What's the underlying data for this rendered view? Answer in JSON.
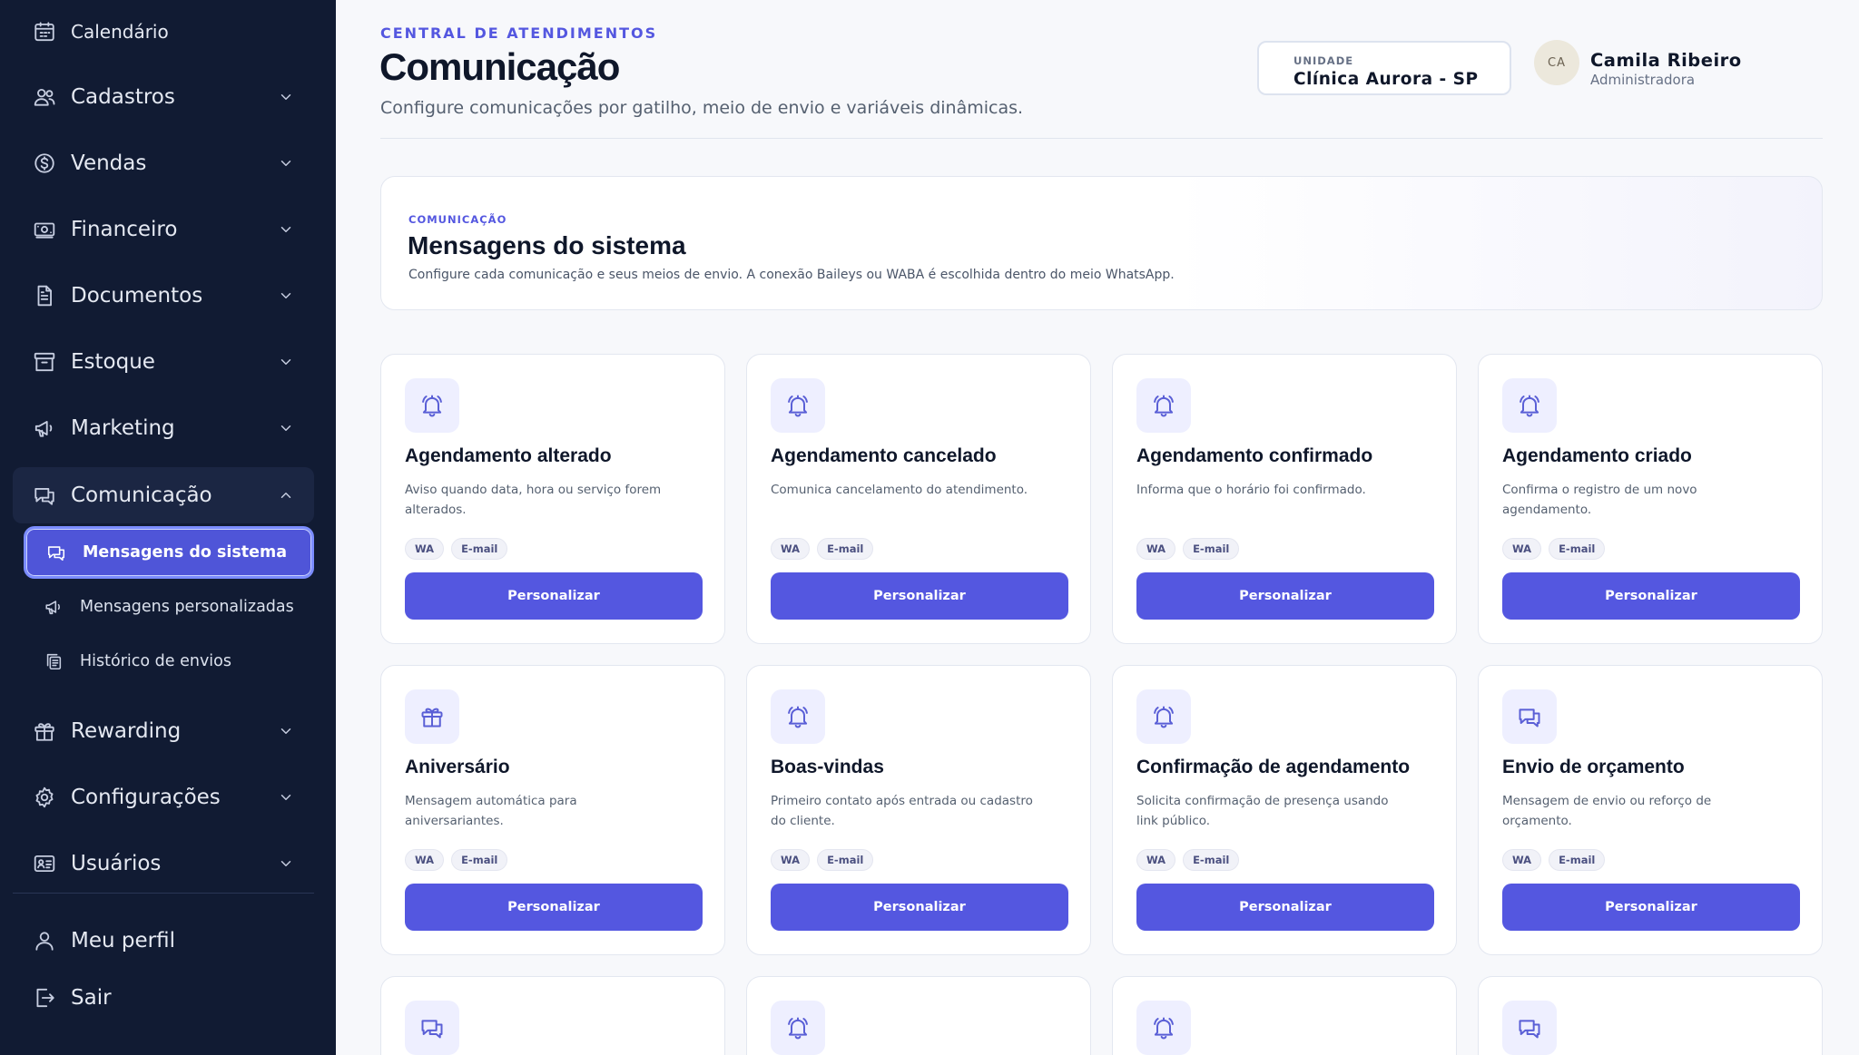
{
  "sidebar": {
    "items": [
      {
        "label": "Calendário",
        "icon": "calendar-icon"
      },
      {
        "label": "Cadastros",
        "icon": "users-icon"
      },
      {
        "label": "Vendas",
        "icon": "dollar-icon"
      },
      {
        "label": "Financeiro",
        "icon": "banknote-icon"
      },
      {
        "label": "Documentos",
        "icon": "file-icon"
      },
      {
        "label": "Estoque",
        "icon": "archive-icon"
      },
      {
        "label": "Marketing",
        "icon": "megaphone-icon"
      },
      {
        "label": "Comunicação",
        "icon": "chat-icon"
      },
      {
        "label": "Rewarding",
        "icon": "gift-icon"
      },
      {
        "label": "Configurações",
        "icon": "gear-icon"
      },
      {
        "label": "Usuários",
        "icon": "id-card-icon"
      }
    ],
    "subitems": [
      {
        "label": "Mensagens do sistema",
        "icon": "chat-icon"
      },
      {
        "label": "Mensagens personalizadas",
        "icon": "megaphone-icon"
      },
      {
        "label": "Histórico de envios",
        "icon": "copy-icon"
      }
    ],
    "footer": [
      {
        "label": "Meu perfil",
        "icon": "user-icon"
      },
      {
        "label": "Sair",
        "icon": "logout-icon"
      }
    ]
  },
  "header": {
    "kicker": "CENTRAL DE ATENDIMENTOS",
    "title": "Comunicação",
    "subtitle": "Configure comunicações por gatilho, meio de envio e variáveis dinâmicas.",
    "unit_label": "UNIDADE",
    "unit_value": "Clínica Aurora - SP",
    "avatar_initials": "CA",
    "user_name": "Camila Ribeiro",
    "user_role": "Administradora"
  },
  "intro": {
    "kicker": "COMUNICAÇÃO",
    "title": "Mensagens do sistema",
    "description": "Configure cada comunicação e seus meios de envio. A conexão Baileys ou WABA é escolhida dentro do meio WhatsApp."
  },
  "cards": [
    {
      "title": "Agendamento alterado",
      "description": "Aviso quando data, hora ou serviço forem alterados.",
      "tags": [
        "WA",
        "E-mail"
      ],
      "button": "Personalizar",
      "icon": "bell-icon"
    },
    {
      "title": "Agendamento cancelado",
      "description": "Comunica cancelamento do atendimento.",
      "tags": [
        "WA",
        "E-mail"
      ],
      "button": "Personalizar",
      "icon": "bell-icon"
    },
    {
      "title": "Agendamento confirmado",
      "description": "Informa que o horário foi confirmado.",
      "tags": [
        "WA",
        "E-mail"
      ],
      "button": "Personalizar",
      "icon": "bell-icon"
    },
    {
      "title": "Agendamento criado",
      "description": "Confirma o registro de um novo agendamento.",
      "tags": [
        "WA",
        "E-mail"
      ],
      "button": "Personalizar",
      "icon": "bell-icon"
    },
    {
      "title": "Aniversário",
      "description": "Mensagem automática para aniversariantes.",
      "tags": [
        "WA",
        "E-mail"
      ],
      "button": "Personalizar",
      "icon": "gift-icon"
    },
    {
      "title": "Boas-vindas",
      "description": "Primeiro contato após entrada ou cadastro do cliente.",
      "tags": [
        "WA",
        "E-mail"
      ],
      "button": "Personalizar",
      "icon": "bell-icon"
    },
    {
      "title": "Confirmação de agendamento",
      "description": "Solicita confirmação de presença usando link público.",
      "tags": [
        "WA",
        "E-mail"
      ],
      "button": "Personalizar",
      "icon": "bell-icon"
    },
    {
      "title": "Envio de orçamento",
      "description": "Mensagem de envio ou reforço de orçamento.",
      "tags": [
        "WA",
        "E-mail"
      ],
      "button": "Personalizar",
      "icon": "chat-icon"
    }
  ],
  "partial_cards": [
    {
      "icon": "chat-icon"
    },
    {
      "icon": "bell-icon"
    },
    {
      "icon": "bell-icon"
    },
    {
      "icon": "chat-icon"
    }
  ],
  "colors": {
    "accent": "#5457e0",
    "sidebar_bg": "#111b33",
    "active_item": "#4f55d8"
  }
}
